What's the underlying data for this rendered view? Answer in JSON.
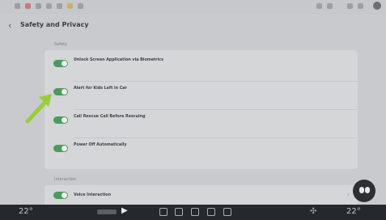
{
  "header": {
    "title": "Safety and Privacy",
    "back_glyph": "‹"
  },
  "statusbar": {
    "pill_text": "",
    "time": ""
  },
  "section1": {
    "label": "Safety",
    "items": [
      {
        "title": "Unlock Screen Application via Biometrics",
        "desc": "",
        "enabled": true
      },
      {
        "title": "Alert for Kids Left in Car",
        "desc": "",
        "enabled": true
      },
      {
        "title": "Call Rescue Call Before Rescuing",
        "desc": "",
        "enabled": true
      },
      {
        "title": "Power Off Automatically",
        "desc": "",
        "enabled": true
      }
    ]
  },
  "section2": {
    "label": "Interaction",
    "items": [
      {
        "title": "Voice Interaction",
        "enabled": true
      }
    ]
  },
  "dock": {
    "temp_left": "22",
    "temp_right": "22",
    "temp_unit": "°",
    "play_glyph": "▶",
    "fan_glyph": "✣"
  },
  "colors": {
    "toggle_on": "#4c9a5e",
    "arrow": "#9bcc3c",
    "dock_bg": "#25282c"
  },
  "icons": [
    "back-icon",
    "arrow-annotation-icon",
    "assistant-icon",
    "play-icon",
    "home-icon",
    "fan-icon"
  ]
}
